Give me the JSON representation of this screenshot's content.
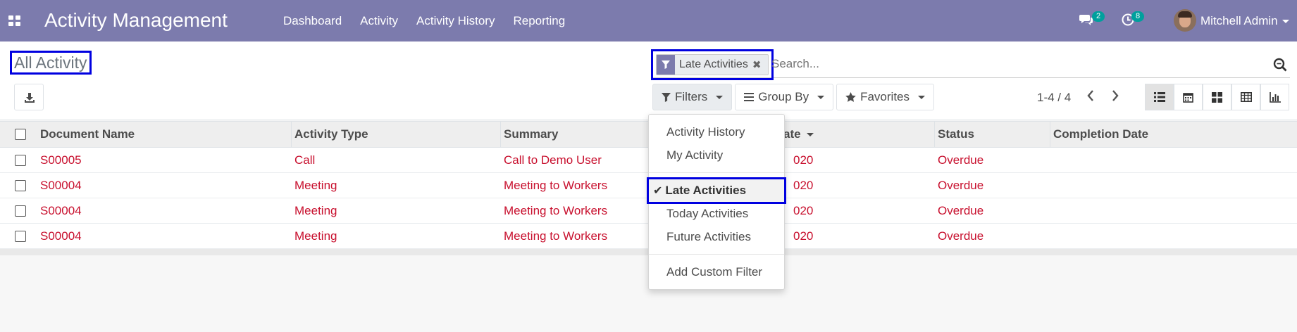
{
  "app": {
    "title": "Activity Management",
    "menu": [
      "Dashboard",
      "Activity",
      "Activity History",
      "Reporting"
    ],
    "user_name": "Mitchell Admin",
    "messages_count": "2",
    "activities_count": "8"
  },
  "control_panel": {
    "title": "All Activity",
    "search": {
      "placeholder": "Search...",
      "facet": "Late Activities"
    },
    "filters_label": "Filters",
    "group_by_label": "Group By",
    "favorites_label": "Favorites",
    "pager": "1-4 / 4"
  },
  "filters_dropdown": {
    "items": [
      "Activity History",
      "My Activity",
      "Late Activities",
      "Today Activities",
      "Future Activities",
      "Add Custom Filter"
    ],
    "selected": "Late Activities"
  },
  "table": {
    "columns": [
      "Document Name",
      "Activity Type",
      "Summary",
      "ate",
      "Status",
      "Completion Date"
    ],
    "rows": [
      {
        "document": "S00005",
        "type": "Call",
        "summary": "Call to Demo User",
        "date": "020",
        "status": "Overdue",
        "completion": ""
      },
      {
        "document": "S00004",
        "type": "Meeting",
        "summary": "Meeting to Workers",
        "date": "020",
        "status": "Overdue",
        "completion": ""
      },
      {
        "document": "S00004",
        "type": "Meeting",
        "summary": "Meeting to Workers",
        "date": "020",
        "status": "Overdue",
        "completion": ""
      },
      {
        "document": "S00004",
        "type": "Meeting",
        "summary": "Meeting to Workers",
        "date": "020",
        "status": "Overdue",
        "completion": ""
      }
    ]
  },
  "colors": {
    "navbar": "#7c7bad",
    "overdue_text": "#c8102e",
    "highlight_box": "#0000e0",
    "badge": "#00a09d"
  }
}
